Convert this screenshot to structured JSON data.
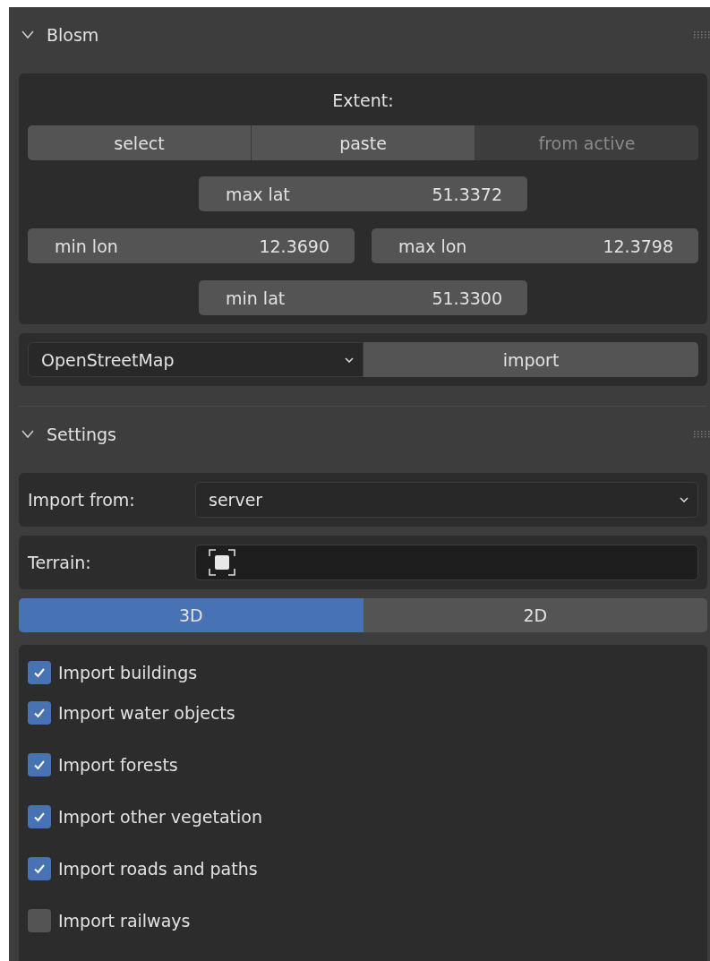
{
  "panels": [
    {
      "title": "Blosm",
      "expanded": true
    },
    {
      "title": "Settings",
      "expanded": true
    }
  ],
  "extent": {
    "label": "Extent:",
    "buttons": [
      {
        "label": "select",
        "disabled": false
      },
      {
        "label": "paste",
        "disabled": false
      },
      {
        "label": "from active",
        "disabled": true
      }
    ],
    "max_lat": {
      "label": "max lat",
      "value": "51.3372"
    },
    "min_lon": {
      "label": "min lon",
      "value": "12.3690"
    },
    "max_lon": {
      "label": "max lon",
      "value": "12.3798"
    },
    "min_lat": {
      "label": "min lat",
      "value": "51.3300"
    }
  },
  "source": {
    "value": "OpenStreetMap",
    "button": "import"
  },
  "import_from": {
    "label": "Import from:",
    "value": "server"
  },
  "terrain": {
    "label": "Terrain:"
  },
  "tabs": [
    {
      "label": "3D",
      "selected": true
    },
    {
      "label": "2D",
      "selected": false
    }
  ],
  "options": [
    {
      "label": "Import buildings",
      "checked": true
    },
    {
      "label": "Import water objects",
      "checked": true
    },
    {
      "label": "Import forests",
      "checked": true
    },
    {
      "label": "Import other vegetation",
      "checked": true
    },
    {
      "label": "Import roads and paths",
      "checked": true
    },
    {
      "label": "Import railways",
      "checked": false
    }
  ]
}
